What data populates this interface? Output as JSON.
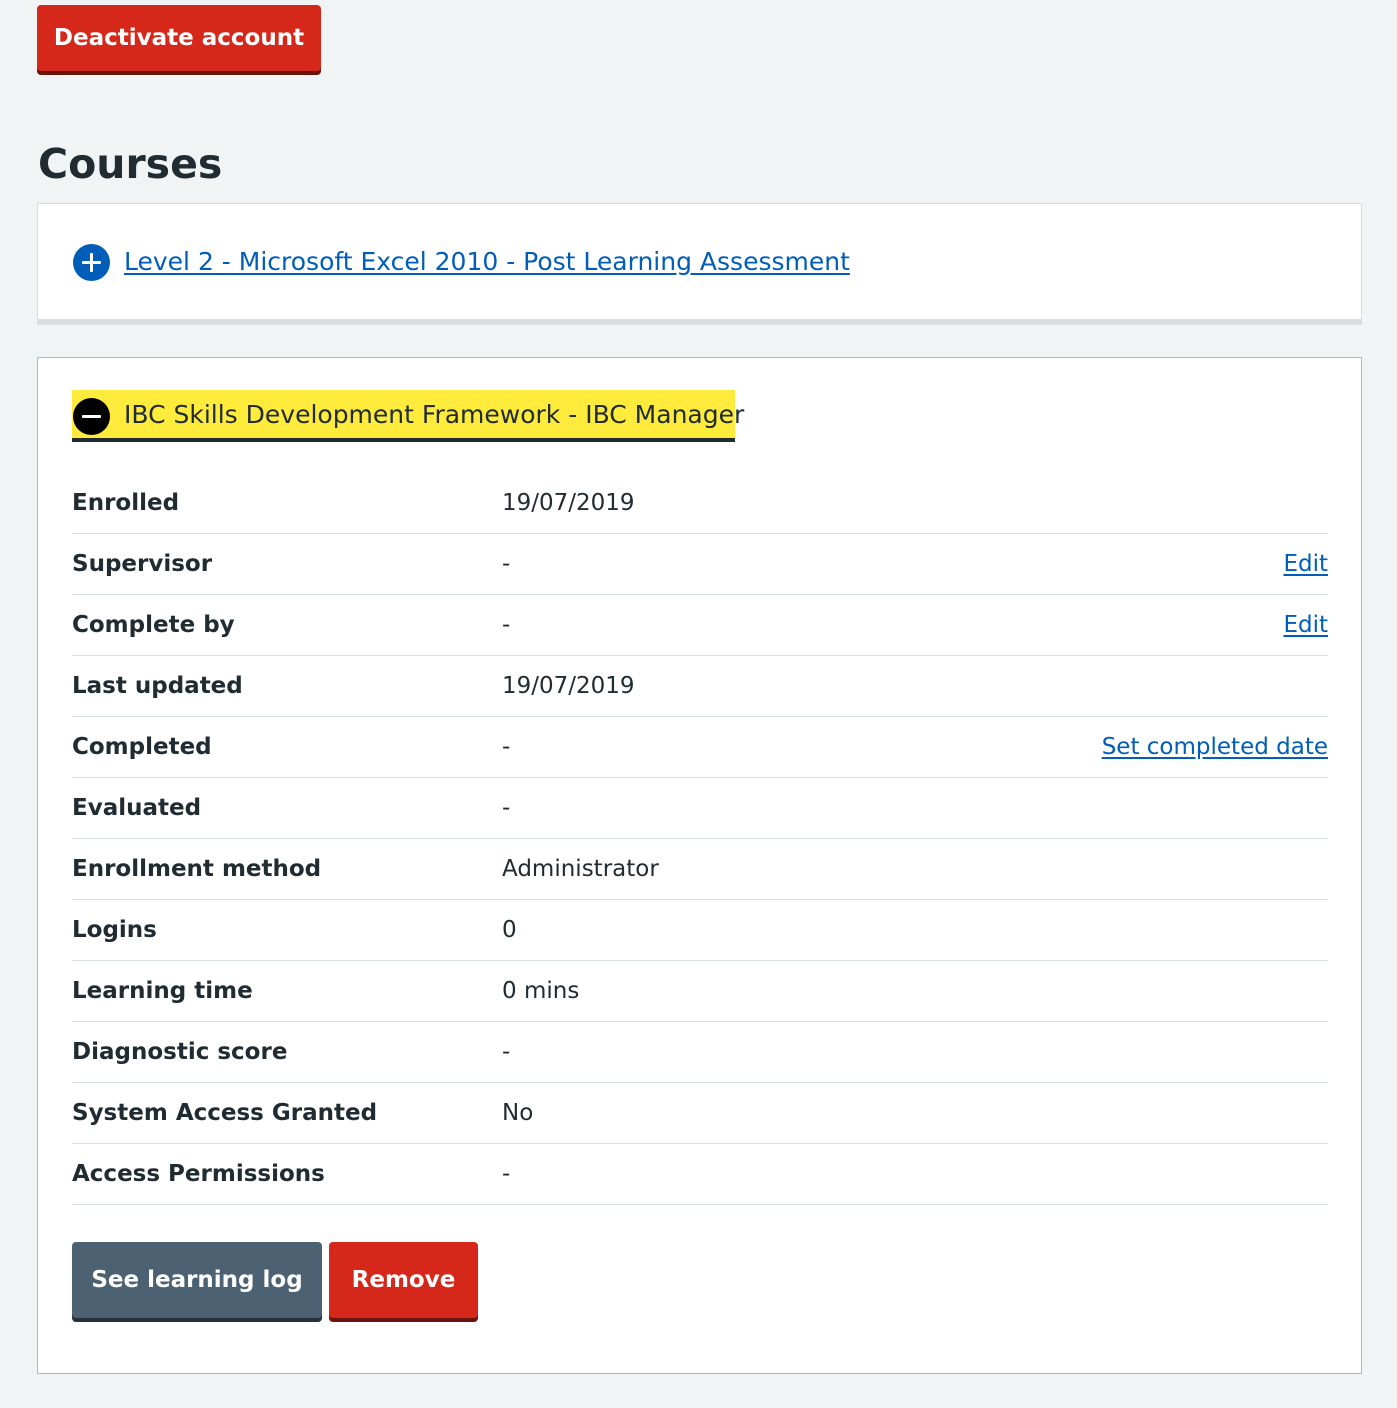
{
  "actions": {
    "deactivate_label": "Deactivate account"
  },
  "section": {
    "title": "Courses"
  },
  "courses": [
    {
      "title": "Level 2 - Microsoft Excel 2010 - Post Learning Assessment",
      "expanded": false,
      "icon": "plus-circle-icon",
      "icon_color": "#005eb8"
    },
    {
      "title": "IBC Skills Development Framework - IBC Manager",
      "expanded": true,
      "icon": "minus-circle-icon",
      "highlight_color": "#ffeb3b",
      "details": [
        {
          "label": "Enrolled",
          "value": "19/07/2019",
          "action": ""
        },
        {
          "label": "Supervisor",
          "value": "-",
          "action": "Edit"
        },
        {
          "label": "Complete by",
          "value": "-",
          "action": "Edit"
        },
        {
          "label": "Last updated",
          "value": "19/07/2019",
          "action": ""
        },
        {
          "label": "Completed",
          "value": "-",
          "action": "Set completed date"
        },
        {
          "label": "Evaluated",
          "value": "-",
          "action": ""
        },
        {
          "label": "Enrollment method",
          "value": "Administrator",
          "action": ""
        },
        {
          "label": "Logins",
          "value": "0",
          "action": ""
        },
        {
          "label": "Learning time",
          "value": "0 mins",
          "action": ""
        },
        {
          "label": "Diagnostic score",
          "value": "-",
          "action": ""
        },
        {
          "label": "System Access Granted",
          "value": "No",
          "action": ""
        },
        {
          "label": "Access Permissions",
          "value": "-",
          "action": ""
        }
      ],
      "buttons": {
        "learning_log_label": "See learning log",
        "remove_label": "Remove"
      }
    }
  ],
  "colors": {
    "background": "#f0f4f5",
    "danger": "#d5281b",
    "secondary": "#4c6272",
    "link": "#005eb8",
    "text": "#212b32"
  }
}
